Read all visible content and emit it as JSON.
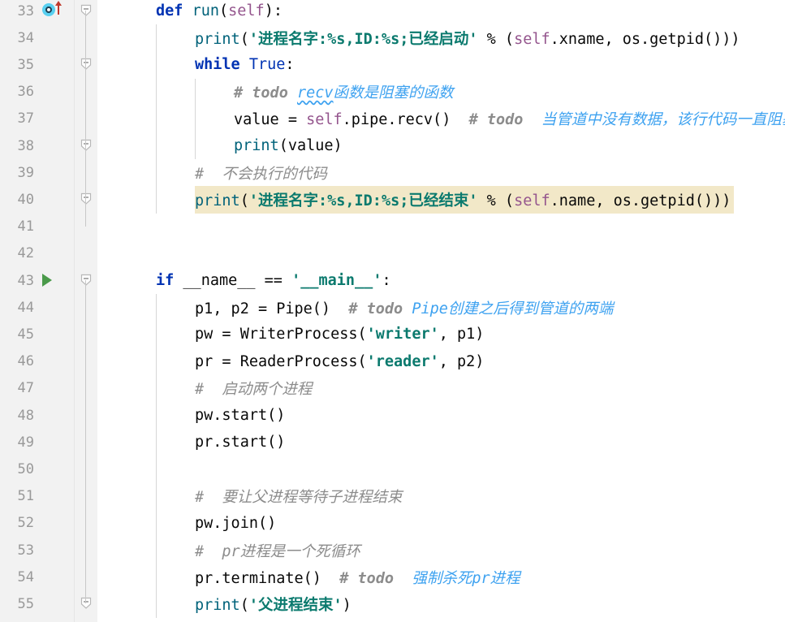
{
  "editor": {
    "app": "code-editor",
    "language": "python",
    "font_size_px": 18.5,
    "line_height_px": 33.2,
    "colors": {
      "background": "#ffffff",
      "gutter_background": "#f2f2f2",
      "line_number": "#999999",
      "keyword": "#0033b3",
      "string": "#0b7a6e",
      "comment": "#8c8c8c",
      "todo_comment": "#3ea2f0",
      "self_param": "#94558d",
      "function_call": "#00627a",
      "caret_row_highlight": "#f2e8c8",
      "indent_guide": "#d6d6d6",
      "fold_rail": "#c8c8c8",
      "run_marker": "#4a9a4a",
      "override_marker": "#59d0f0",
      "override_arrow": "#c0392b"
    },
    "highlighted_line": 40,
    "gutter_markers": [
      {
        "line": 33,
        "icon": "override-method-icon"
      },
      {
        "line": 43,
        "icon": "run-play-icon"
      }
    ],
    "fold_markers": [
      33,
      35,
      38,
      40,
      43,
      55
    ],
    "lines": [
      {
        "number": 33,
        "indent": 0,
        "highlighted": false,
        "tokens": [
          {
            "t": "def ",
            "c": "tk-kw"
          },
          {
            "t": "run",
            "c": "tk-fn"
          },
          {
            "t": "(",
            "c": "tk-plain"
          },
          {
            "t": "self",
            "c": "tk-self"
          },
          {
            "t": "):",
            "c": "tk-plain"
          }
        ]
      },
      {
        "number": 34,
        "indent": 1,
        "highlighted": false,
        "tokens": [
          {
            "t": "print",
            "c": "tk-print"
          },
          {
            "t": "(",
            "c": "tk-plain"
          },
          {
            "t": "'",
            "c": "tk-strq"
          },
          {
            "t": "进程名字:%s,ID:%s;已经启动",
            "c": "tk-strcn"
          },
          {
            "t": "'",
            "c": "tk-strq"
          },
          {
            "t": " % (",
            "c": "tk-plain"
          },
          {
            "t": "self",
            "c": "tk-self"
          },
          {
            "t": ".xname, os.getpid()))",
            "c": "tk-plain"
          }
        ]
      },
      {
        "number": 35,
        "indent": 1,
        "highlighted": false,
        "tokens": [
          {
            "t": "while ",
            "c": "tk-kw"
          },
          {
            "t": "True",
            "c": "tk-builtin"
          },
          {
            "t": ":",
            "c": "tk-plain"
          }
        ]
      },
      {
        "number": 36,
        "indent": 2,
        "highlighted": false,
        "tokens": [
          {
            "t": "# ",
            "c": "tk-todo"
          },
          {
            "t": "todo ",
            "c": "tk-todo"
          },
          {
            "t": "recv",
            "c": "tk-todoblue squiggle"
          },
          {
            "t": "函数是阻塞的函数",
            "c": "tk-todoblue"
          }
        ]
      },
      {
        "number": 37,
        "indent": 2,
        "highlighted": false,
        "tokens": [
          {
            "t": "value = ",
            "c": "tk-plain"
          },
          {
            "t": "self",
            "c": "tk-self"
          },
          {
            "t": ".pipe.recv()",
            "c": "tk-plain"
          },
          {
            "t": "  # ",
            "c": "tk-todo"
          },
          {
            "t": "todo ",
            "c": "tk-todo"
          },
          {
            "t": " 当管道中没有数据，该行代码一直阻塞",
            "c": "tk-todoblue"
          }
        ]
      },
      {
        "number": 38,
        "indent": 2,
        "highlighted": false,
        "tokens": [
          {
            "t": "print",
            "c": "tk-print"
          },
          {
            "t": "(value)",
            "c": "tk-plain"
          }
        ]
      },
      {
        "number": 39,
        "indent": 1,
        "highlighted": false,
        "tokens": [
          {
            "t": "# ",
            "c": "tk-cm"
          },
          {
            "t": " 不会执行的代码",
            "c": "tk-cm"
          }
        ]
      },
      {
        "number": 40,
        "indent": 1,
        "highlighted": true,
        "tokens": [
          {
            "t": "print",
            "c": "tk-print"
          },
          {
            "t": "(",
            "c": "tk-plain"
          },
          {
            "t": "'",
            "c": "tk-strq"
          },
          {
            "t": "进程名字:%s,ID:%s;已经结束",
            "c": "tk-strcn"
          },
          {
            "t": "'",
            "c": "tk-strq"
          },
          {
            "t": " % (",
            "c": "tk-plain"
          },
          {
            "t": "self",
            "c": "tk-self"
          },
          {
            "t": ".name, os.getpid()))",
            "c": "tk-plain"
          }
        ]
      },
      {
        "number": 41,
        "indent": 0,
        "highlighted": false,
        "tokens": []
      },
      {
        "number": 42,
        "indent": 0,
        "highlighted": false,
        "tokens": []
      },
      {
        "number": 43,
        "indent": 0,
        "highlighted": false,
        "tokens": [
          {
            "t": "if ",
            "c": "tk-kw"
          },
          {
            "t": "__name__ == ",
            "c": "tk-plain"
          },
          {
            "t": "'",
            "c": "tk-strq"
          },
          {
            "t": "__main__",
            "c": "tk-strcn"
          },
          {
            "t": "'",
            "c": "tk-strq"
          },
          {
            "t": ":",
            "c": "tk-plain"
          }
        ]
      },
      {
        "number": 44,
        "indent": 1,
        "highlighted": false,
        "tokens": [
          {
            "t": "p1, p2 = Pipe()",
            "c": "tk-plain"
          },
          {
            "t": "  # ",
            "c": "tk-todo"
          },
          {
            "t": "todo ",
            "c": "tk-todo"
          },
          {
            "t": "Pipe",
            "c": "tk-todoblue"
          },
          {
            "t": "创建之后得到管道的两端",
            "c": "tk-todoblue"
          }
        ]
      },
      {
        "number": 45,
        "indent": 1,
        "highlighted": false,
        "tokens": [
          {
            "t": "pw = WriterProcess(",
            "c": "tk-plain"
          },
          {
            "t": "'",
            "c": "tk-strq"
          },
          {
            "t": "writer",
            "c": "tk-strcn"
          },
          {
            "t": "'",
            "c": "tk-strq"
          },
          {
            "t": ", p1)",
            "c": "tk-plain"
          }
        ]
      },
      {
        "number": 46,
        "indent": 1,
        "highlighted": false,
        "tokens": [
          {
            "t": "pr = ReaderProcess(",
            "c": "tk-plain"
          },
          {
            "t": "'",
            "c": "tk-strq"
          },
          {
            "t": "reader",
            "c": "tk-strcn"
          },
          {
            "t": "'",
            "c": "tk-strq"
          },
          {
            "t": ", p2)",
            "c": "tk-plain"
          }
        ]
      },
      {
        "number": 47,
        "indent": 1,
        "highlighted": false,
        "tokens": [
          {
            "t": "# ",
            "c": "tk-cm"
          },
          {
            "t": " 启动两个进程",
            "c": "tk-cm"
          }
        ]
      },
      {
        "number": 48,
        "indent": 1,
        "highlighted": false,
        "tokens": [
          {
            "t": "pw.start()",
            "c": "tk-plain"
          }
        ]
      },
      {
        "number": 49,
        "indent": 1,
        "highlighted": false,
        "tokens": [
          {
            "t": "pr.start()",
            "c": "tk-plain"
          }
        ]
      },
      {
        "number": 50,
        "indent": 0,
        "highlighted": false,
        "tokens": []
      },
      {
        "number": 51,
        "indent": 1,
        "highlighted": false,
        "tokens": [
          {
            "t": "# ",
            "c": "tk-cm"
          },
          {
            "t": " 要让父进程等待子进程结束",
            "c": "tk-cm"
          }
        ]
      },
      {
        "number": 52,
        "indent": 1,
        "highlighted": false,
        "tokens": [
          {
            "t": "pw.join()",
            "c": "tk-plain"
          }
        ]
      },
      {
        "number": 53,
        "indent": 1,
        "highlighted": false,
        "tokens": [
          {
            "t": "# ",
            "c": "tk-cm"
          },
          {
            "t": " pr",
            "c": "tk-cm"
          },
          {
            "t": "进程是一个死循环",
            "c": "tk-cm"
          }
        ]
      },
      {
        "number": 54,
        "indent": 1,
        "highlighted": false,
        "tokens": [
          {
            "t": "pr.terminate()",
            "c": "tk-plain"
          },
          {
            "t": "  # ",
            "c": "tk-todo"
          },
          {
            "t": "todo ",
            "c": "tk-todo"
          },
          {
            "t": " 强制杀死pr",
            "c": "tk-todoblue"
          },
          {
            "t": "进程",
            "c": "tk-todoblue"
          }
        ]
      },
      {
        "number": 55,
        "indent": 1,
        "highlighted": false,
        "tokens": [
          {
            "t": "print",
            "c": "tk-print"
          },
          {
            "t": "(",
            "c": "tk-plain"
          },
          {
            "t": "'",
            "c": "tk-strq"
          },
          {
            "t": "父进程结束",
            "c": "tk-strcn"
          },
          {
            "t": "'",
            "c": "tk-strq"
          },
          {
            "t": ")",
            "c": "tk-plain"
          }
        ]
      }
    ]
  }
}
